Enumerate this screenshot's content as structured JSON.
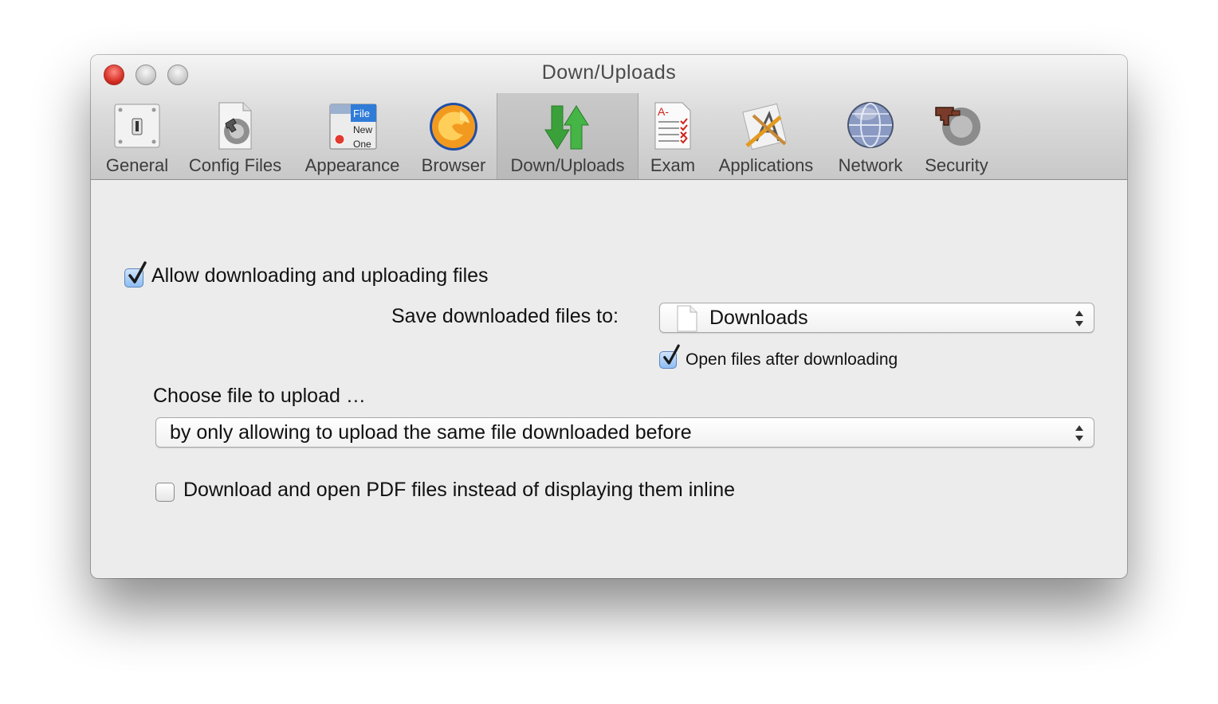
{
  "window": {
    "title": "Down/Uploads"
  },
  "toolbar": {
    "items": [
      {
        "label": "General",
        "icon": "switch-icon"
      },
      {
        "label": "Config Files",
        "icon": "config-files-icon"
      },
      {
        "label": "Appearance",
        "icon": "appearance-icon"
      },
      {
        "label": "Browser",
        "icon": "browser-globe-icon"
      },
      {
        "label": "Down/Uploads",
        "icon": "down-up-arrows-icon",
        "selected": true
      },
      {
        "label": "Exam",
        "icon": "exam-document-icon"
      },
      {
        "label": "Applications",
        "icon": "applications-icon"
      },
      {
        "label": "Network",
        "icon": "network-globe-icon"
      },
      {
        "label": "Security",
        "icon": "security-keys-icon"
      }
    ],
    "appearance_icon_text": [
      "File",
      "New",
      "One"
    ]
  },
  "content": {
    "allow_transfers": {
      "label": "Allow downloading and uploading files",
      "checked": true
    },
    "save_to": {
      "label": "Save downloaded files to:",
      "value": "Downloads"
    },
    "open_after": {
      "label": "Open files after downloading",
      "checked": true
    },
    "upload": {
      "label": "Choose file to upload …",
      "value": "by only allowing to upload the same file downloaded before"
    },
    "pdf": {
      "label": "Download and open PDF files instead of displaying them inline",
      "checked": false
    }
  },
  "colors": {
    "accent_green": "#3aa13a",
    "close_red": "#d22a20",
    "checkbox_blue": "#8ebdf2"
  }
}
